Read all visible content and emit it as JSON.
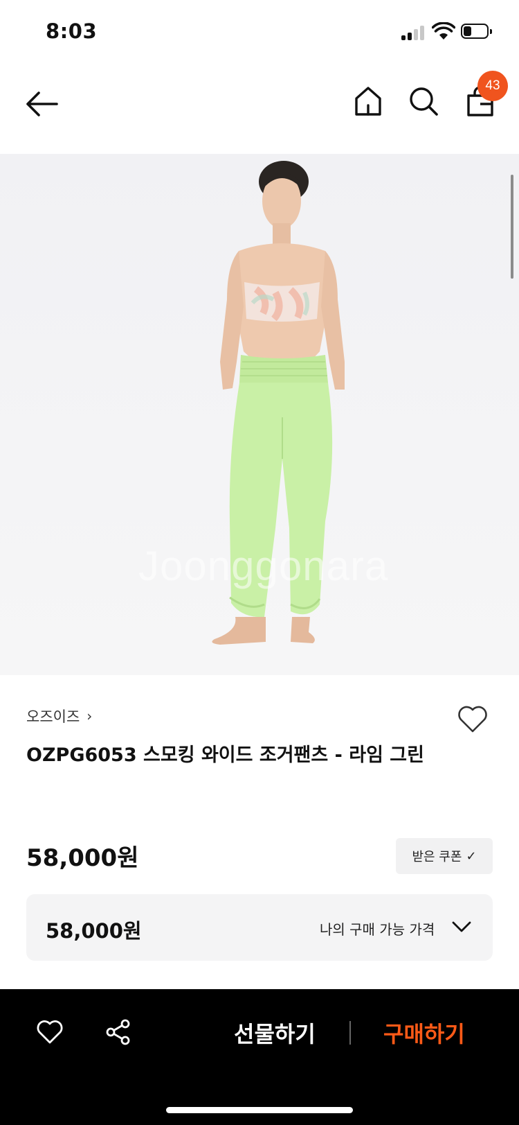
{
  "status_bar": {
    "time": "8:03"
  },
  "header": {
    "cart_count": "43"
  },
  "product": {
    "image_watermark": "Joonggonara",
    "brand": "오즈이즈",
    "title": "OZPG6053 스모킹 와이드 조거팬츠 - 라임 그린",
    "price": "58,000원",
    "coupon_label": "받은 쿠폰",
    "my_price": "58,000원",
    "my_price_label": "나의 구매 가능 가격"
  },
  "bottom_bar": {
    "gift_label": "선물하기",
    "buy_label": "구매하기"
  },
  "colors": {
    "accent": "#ff5a17",
    "badge": "#f0541e",
    "pants": "#c9f0a6"
  }
}
